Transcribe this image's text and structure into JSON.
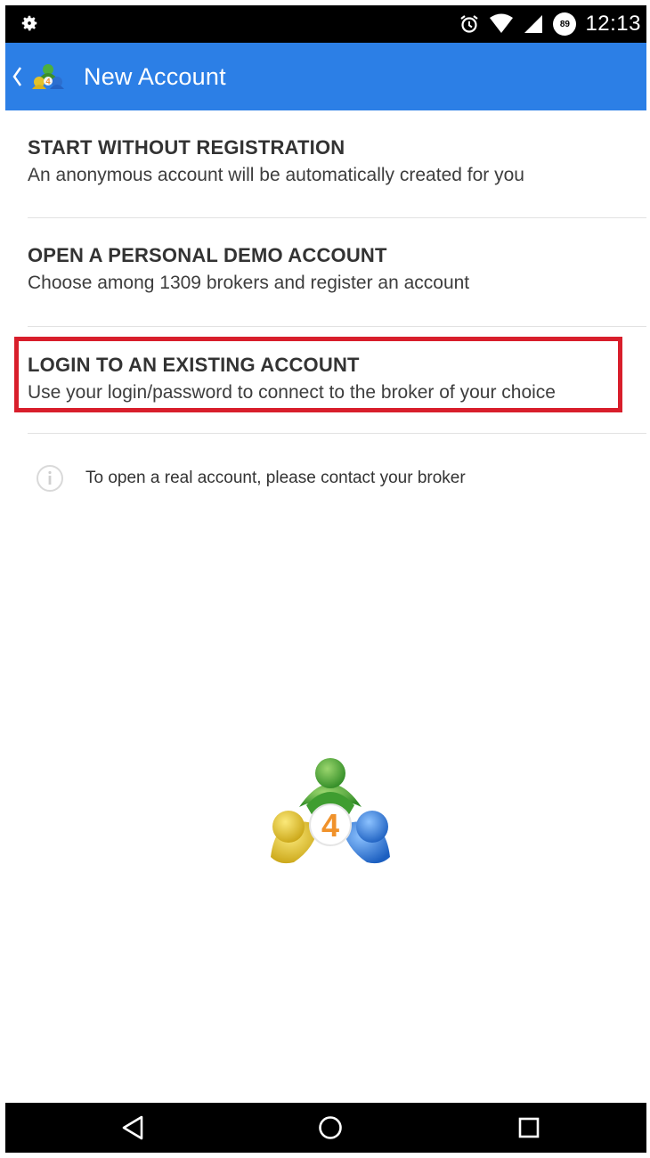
{
  "status_bar": {
    "time": "12:13",
    "battery": "89",
    "icons": [
      "settings-gear-icon",
      "alarm-clock-icon",
      "wifi-icon",
      "cell-signal-icon",
      "battery-icon"
    ]
  },
  "app_bar": {
    "title": "New Account",
    "back_icon": "chevron-left-icon",
    "logo": "metatrader-logo",
    "color": "#2c7fe6"
  },
  "options": [
    {
      "title": "START WITHOUT REGISTRATION",
      "description": "An anonymous account will be automatically created for you"
    },
    {
      "title": "OPEN A PERSONAL DEMO ACCOUNT",
      "description": "Choose among 1309 brokers and register an account"
    },
    {
      "title": "LOGIN TO AN EXISTING ACCOUNT",
      "description": "Use your login/password to connect to the broker of your choice",
      "highlighted": true,
      "highlight_color": "#d81e2b"
    }
  ],
  "info": {
    "icon": "info-icon",
    "text": "To open a real account, please contact your broker"
  },
  "logo_number": "4",
  "nav_bar": {
    "icons": [
      "back-triangle-icon",
      "home-circle-icon",
      "recents-square-icon"
    ]
  }
}
